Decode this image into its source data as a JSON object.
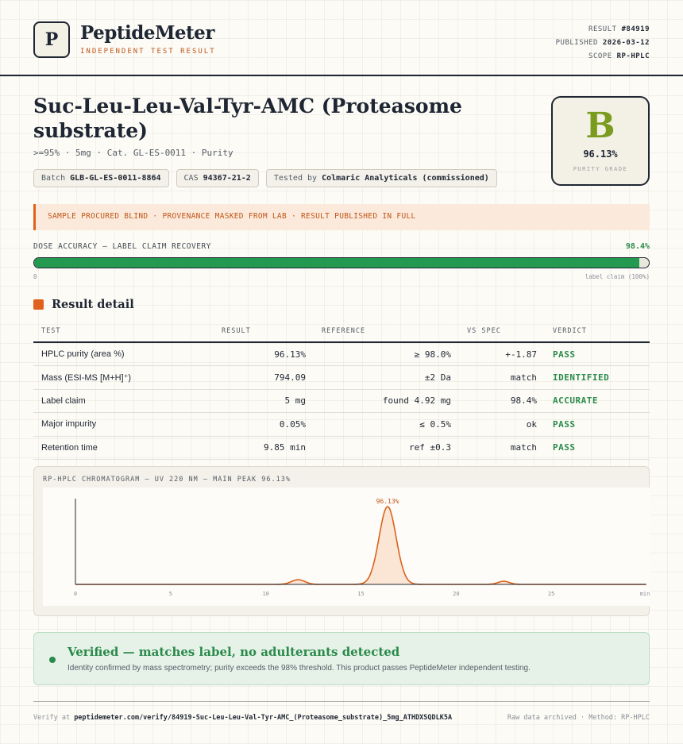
{
  "header": {
    "logo_letter": "P",
    "brand": "PeptideMeter",
    "brand_sub": "INDEPENDENT TEST RESULT",
    "result_label": "RESULT",
    "result_value": "#84919",
    "published_label": "PUBLISHED",
    "published_value": "2026-03-12",
    "scope_label": "SCOPE",
    "scope_value": "RP-HPLC"
  },
  "product": {
    "title": "Suc-Leu-Leu-Val-Tyr-AMC (Proteasome substrate)",
    "subtitle": ">=95% · 5mg · Cat. GL-ES-0011 · Purity",
    "chips": [
      {
        "label": "Batch",
        "value": "GLB-GL-ES-0011-8864"
      },
      {
        "label": "CAS",
        "value": "94367-21-2"
      },
      {
        "label": "Tested by",
        "value": "Colmaric Analyticals (commissioned)"
      }
    ]
  },
  "grade": {
    "letter": "B",
    "value": "96.13%",
    "label": "PURITY GRADE",
    "color": "#7a9c1e"
  },
  "notice": "SAMPLE PROCURED BLIND · PROVENANCE MASKED FROM LAB · RESULT PUBLISHED IN FULL",
  "dose": {
    "label": "DOSE ACCURACY — LABEL CLAIM RECOVERY",
    "value_text": "98.4%",
    "fraction": 0.984,
    "min_label": "0",
    "max_label": "label claim (100%)"
  },
  "section_title": "Result detail",
  "table": {
    "headers": [
      "TEST",
      "RESULT",
      "REFERENCE",
      "VS SPEC",
      "VERDICT"
    ],
    "rows": [
      {
        "test": "HPLC purity (area %)",
        "result": "96.13%",
        "reference": "≥ 98.0%",
        "vs": "+-1.87",
        "verdict": "PASS"
      },
      {
        "test": "Mass (ESI-MS [M+H]⁺)",
        "result": "794.09",
        "reference": "±2 Da",
        "vs": "match",
        "verdict": "IDENTIFIED"
      },
      {
        "test": "Label claim",
        "result": "5 mg",
        "reference": "found 4.92 mg",
        "vs": "98.4%",
        "verdict": "ACCURATE"
      },
      {
        "test": "Major impurity",
        "result": "0.05%",
        "reference": "≤ 0.5%",
        "vs": "ok",
        "verdict": "PASS"
      },
      {
        "test": "Retention time",
        "result": "9.85 min",
        "reference": "ref ±0.3",
        "vs": "match",
        "verdict": "PASS"
      }
    ]
  },
  "chromatogram": {
    "label": "RP-HPLC CHROMATOGRAM — UV 220 NM — MAIN PEAK 96.13%",
    "peak_label": "96.13%",
    "x_ticks": [
      "0",
      "5",
      "10",
      "15",
      "20",
      "25",
      "min"
    ],
    "line_color": "#d9631e",
    "fill_color": "#fbe6d6"
  },
  "chart_data": {
    "type": "line",
    "title": "RP-HPLC CHROMATOGRAM — UV 220 NM — MAIN PEAK 96.13%",
    "xlabel": "min",
    "ylabel": "",
    "xlim": [
      0,
      30
    ],
    "ylim": [
      0,
      100
    ],
    "x_ticks": [
      0,
      5,
      10,
      15,
      20,
      25
    ],
    "peaks": [
      {
        "x": 11.7,
        "height": 6
      },
      {
        "x": 16.4,
        "height": 100,
        "label": "96.13%"
      },
      {
        "x": 22.5,
        "height": 4
      }
    ]
  },
  "verified": {
    "title": "Verified — matches label, no adulterants detected",
    "description": "Identity confirmed by mass spectrometry; purity exceeds the 98% threshold. This product passes PeptideMeter independent testing."
  },
  "footer": {
    "verify_prefix": "Verify at",
    "verify_url": "peptidemeter.com/verify/84919-Suc-Leu-Leu-Val-Tyr-AMC_(Proteasome_substrate)_5mg_ATHDXSQDLK5A",
    "right_text": "Raw data archived · Method: RP-HPLC"
  }
}
